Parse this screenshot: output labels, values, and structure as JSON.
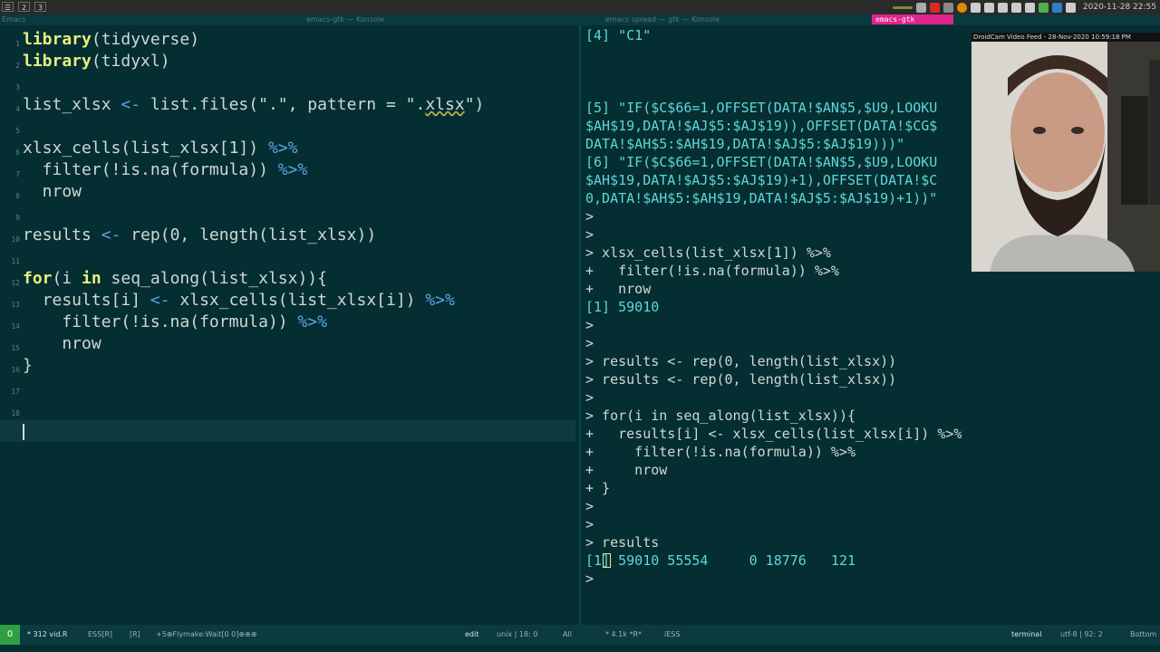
{
  "topbar": {
    "workspaces": [
      "1",
      "2",
      "3"
    ],
    "window_titles": [
      "Emacs",
      "emacs-gtk — Konsole",
      "emacs spread — gtk — Konsole"
    ],
    "emacs_tag": "emacs-gtk",
    "clock": "2020-11-28 22:55"
  },
  "editor": {
    "lines": [
      {
        "n": "1",
        "text": "library(tidyverse)"
      },
      {
        "n": "2",
        "text": "library(tidyxl)"
      },
      {
        "n": "3",
        "text": ""
      },
      {
        "n": "4",
        "text": "list_xlsx <- list.files(\".\", pattern = \".xlsx\")"
      },
      {
        "n": "5",
        "text": ""
      },
      {
        "n": "6",
        "text": "xlsx_cells(list_xlsx[1]) %>%"
      },
      {
        "n": "7",
        "text": "  filter(!is.na(formula)) %>%"
      },
      {
        "n": "8",
        "text": "  nrow"
      },
      {
        "n": "9",
        "text": ""
      },
      {
        "n": "10",
        "text": "results <- rep(0, length(list_xlsx))"
      },
      {
        "n": "11",
        "text": ""
      },
      {
        "n": "12",
        "text": "for(i in seq_along(list_xlsx)){"
      },
      {
        "n": "13",
        "text": "  results[i] <- xlsx_cells(list_xlsx[i]) %>%"
      },
      {
        "n": "14",
        "text": "    filter(!is.na(formula)) %>%"
      },
      {
        "n": "15",
        "text": "    nrow"
      },
      {
        "n": "16",
        "text": "}"
      },
      {
        "n": "17",
        "text": ""
      },
      {
        "n": "18",
        "text": ""
      }
    ]
  },
  "console": {
    "lines": [
      "[4] \"C1\"",
      "",
      "",
      "",
      "[5] \"IF($C$66=1,OFFSET(DATA!$AN$5,$U9,LOOKU",
      "$AH$19,DATA!$AJ$5:$AJ$19)),OFFSET(DATA!$CG$",
      "DATA!$AH$5:$AH$19,DATA!$AJ$5:$AJ$19)))\"",
      "[6] \"IF($C$66=1,OFFSET(DATA!$AN$5,$U9,LOOKU",
      "$AH$19,DATA!$AJ$5:$AJ$19)+1),OFFSET(DATA!$C",
      "0,DATA!$AH$5:$AH$19,DATA!$AJ$5:$AJ$19)+1))\"",
      ">",
      ">",
      "> xlsx_cells(list_xlsx[1]) %>%",
      "+   filter(!is.na(formula)) %>%",
      "+   nrow",
      "[1] 59010",
      ">",
      ">",
      "> results <- rep(0, length(list_xlsx))",
      "> results <- rep(0, length(list_xlsx))",
      ">",
      "> for(i in seq_along(list_xlsx)){",
      "+   results[i] <- xlsx_cells(list_xlsx[i]) %>%",
      "+     filter(!is.na(formula)) %>%",
      "+     nrow",
      "+ }",
      ">",
      ">",
      "> results",
      "[1] 59010 55554     0 18776   121",
      ">"
    ]
  },
  "webcam": {
    "title": "DroidCam Video Feed - 28-Nov-2020 10:59:18 PM"
  },
  "modeline": {
    "state": "0",
    "left": "* 312 vid.R",
    "mode": "ESS[R]",
    "r_tag": "[R]",
    "minor": "+5⊕Flymake:Wait[0 0]⊕⊕⊕",
    "edit": "edit",
    "encoding": "unix | 18: 0",
    "all": "All",
    "right_mid": "* 4.1k *R*",
    "iess": "iESS",
    "terminal": "terminal",
    "utf": "utf-8 | 92: 2",
    "bottom": "Bottom"
  }
}
